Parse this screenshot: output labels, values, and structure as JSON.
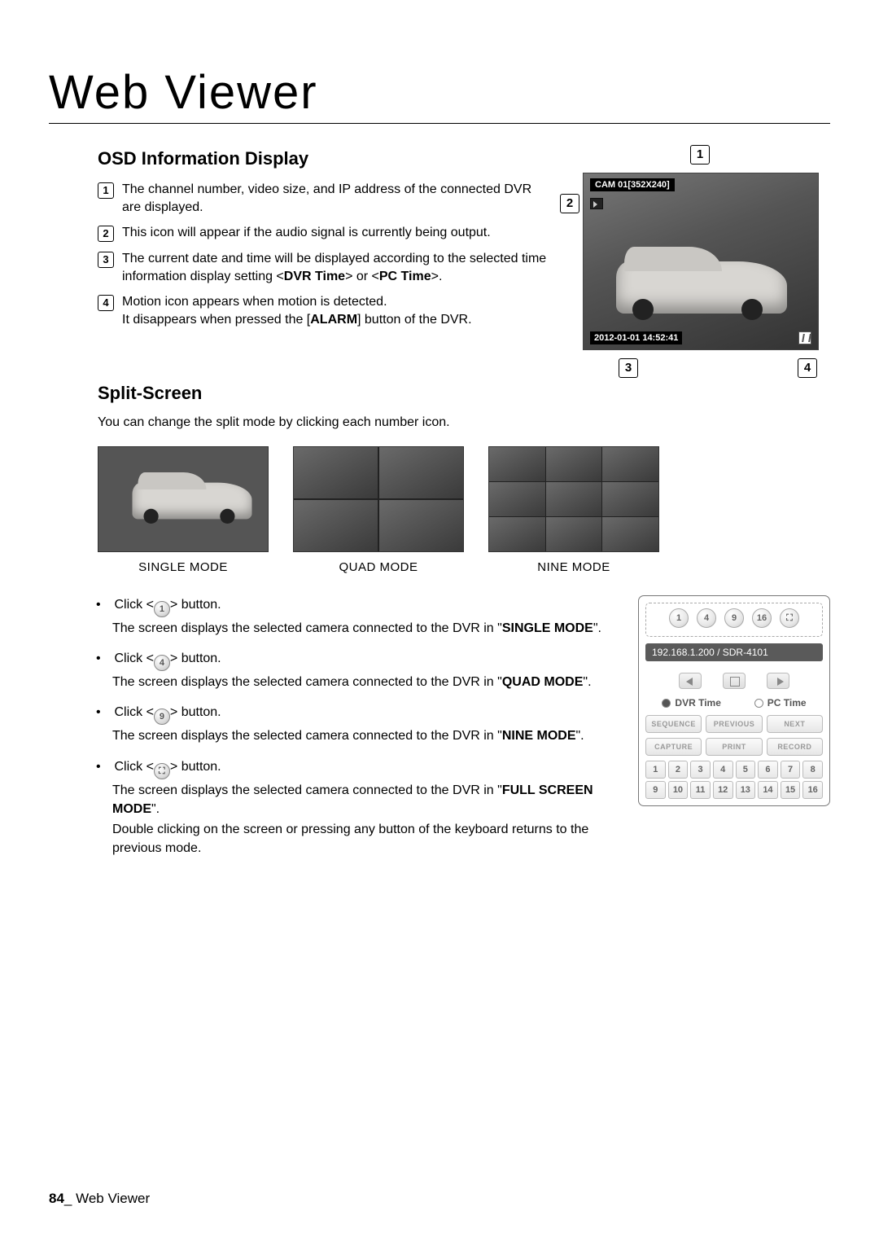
{
  "page_title": "Web Viewer",
  "osd": {
    "heading": "OSD Information Display",
    "items": [
      "The channel number, video size, and IP address of the connected DVR are displayed.",
      "This icon will appear if the audio signal is currently being output.",
      "The current date and time will be displayed according to the selected time information display setting <",
      "Motion icon appears when motion is detected."
    ],
    "item3_dvr": "DVR Time",
    "item3_mid": "> or <",
    "item3_pc": "PC Time",
    "item3_end": ">.",
    "item4_line2_a": "It disappears when pressed the [",
    "item4_alarm": "ALARM",
    "item4_line2_b": "] button of the DVR.",
    "shot": {
      "header": "CAM 01[352X240]",
      "timestamp": "2012-01-01 14:52:41"
    },
    "callouts": [
      "1",
      "2",
      "3",
      "4"
    ]
  },
  "split": {
    "heading": "Split-Screen",
    "intro": "You can change the split mode by clicking each number icon.",
    "modes": {
      "single": "SINGLE MODE",
      "quad": "QUAD MODE",
      "nine": "NINE MODE"
    },
    "bullets": {
      "btn1": "1",
      "btn4": "4",
      "btn9": "9",
      "click_prefix": "Click <",
      "click_suffix": "> button.",
      "line_prefix": "The screen displays the selected camera connected to the DVR in \"",
      "line_suffix": "\".",
      "single_mode": "SINGLE MODE",
      "quad_mode": "QUAD MODE",
      "nine_mode": "NINE MODE",
      "full_mode": "FULL SCREEN MODE",
      "dbl": "Double clicking on the screen or pressing any button of the keyboard returns to the previous mode."
    },
    "panel": {
      "top": [
        "1",
        "4",
        "9",
        "16"
      ],
      "ip_line": "192.168.1.200   /  SDR-4101",
      "dvr_time": "DVR Time",
      "pc_time": "PC Time",
      "row1": [
        "SEQUENCE",
        "PREVIOUS",
        "NEXT"
      ],
      "row2": [
        "CAPTURE",
        "PRINT",
        "RECORD"
      ],
      "channels": [
        "1",
        "2",
        "3",
        "4",
        "5",
        "6",
        "7",
        "8",
        "9",
        "10",
        "11",
        "12",
        "13",
        "14",
        "15",
        "16"
      ]
    }
  },
  "footer": {
    "page_num": "84",
    "section": "Web Viewer",
    "sep": "_ "
  }
}
